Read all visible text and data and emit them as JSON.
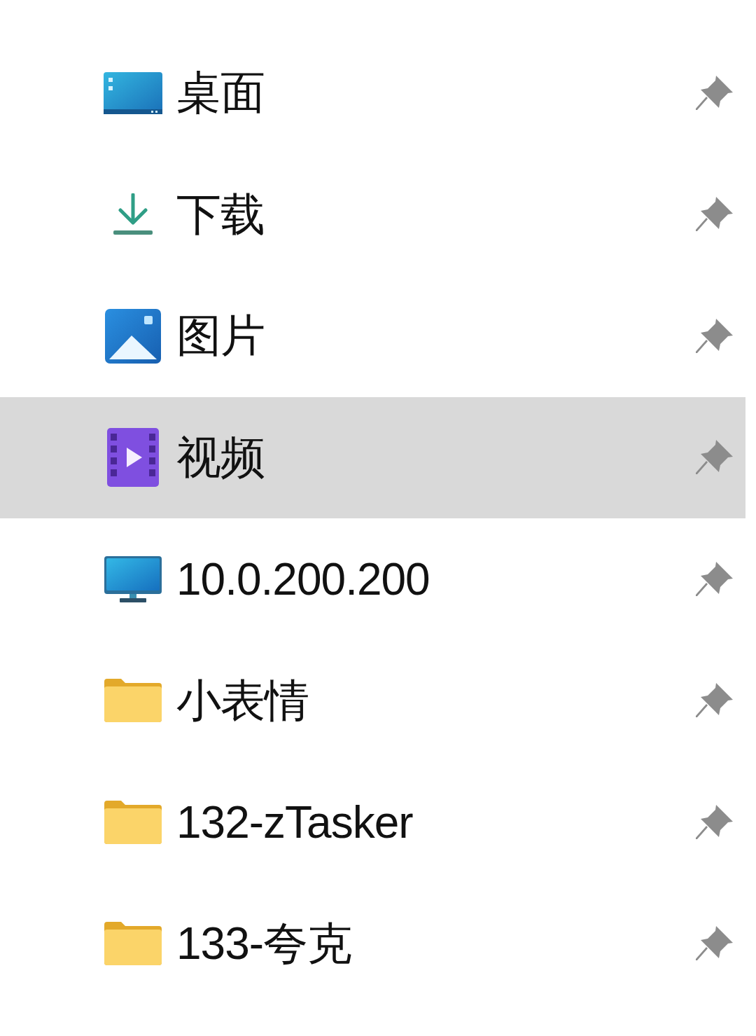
{
  "quick_access": {
    "items": [
      {
        "kind": "desktop",
        "label": "桌面",
        "pinned": true,
        "selected": false
      },
      {
        "kind": "downloads",
        "label": "下载",
        "pinned": true,
        "selected": false
      },
      {
        "kind": "pictures",
        "label": "图片",
        "pinned": true,
        "selected": false
      },
      {
        "kind": "videos",
        "label": "视频",
        "pinned": true,
        "selected": true
      },
      {
        "kind": "computer",
        "label": "10.0.200.200",
        "pinned": true,
        "selected": false
      },
      {
        "kind": "folder",
        "label": "小表情",
        "pinned": true,
        "selected": false
      },
      {
        "kind": "folder",
        "label": "132-zTasker",
        "pinned": true,
        "selected": false
      },
      {
        "kind": "folder",
        "label": "133-夸克",
        "pinned": true,
        "selected": false
      }
    ]
  }
}
